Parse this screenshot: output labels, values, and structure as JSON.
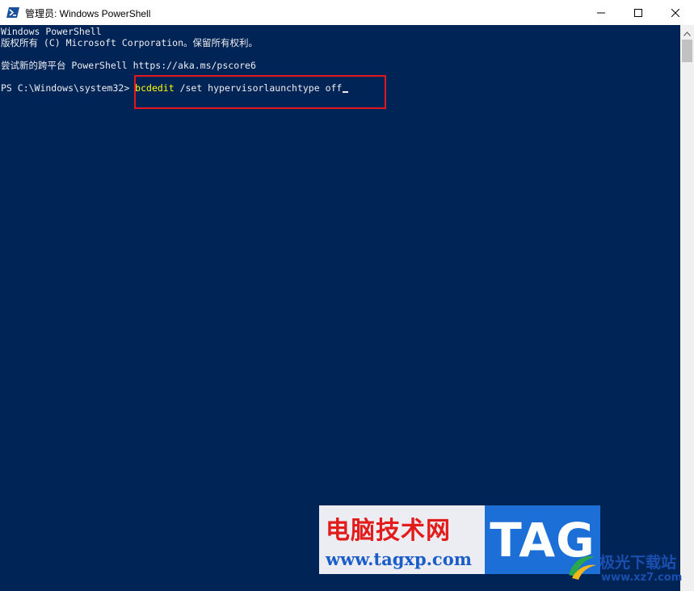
{
  "window": {
    "title": "管理员: Windows PowerShell",
    "controls": {
      "minimize_icon": "minimize-icon",
      "maximize_icon": "maximize-icon",
      "close_icon": "close-icon"
    }
  },
  "console": {
    "lines": [
      "Windows PowerShell",
      "版权所有 (C) Microsoft Corporation。保留所有权利。",
      "",
      "尝试新的跨平台 PowerShell https://aka.ms/pscore6",
      ""
    ],
    "prompt": "PS C:\\Windows\\system32> ",
    "command_keyword": "bcdedit",
    "command_args": " /set hypervisorlaunchtype off",
    "background_color": "#012456",
    "keyword_color": "#ffff00",
    "highlight_color": "#e0171d"
  },
  "watermark": {
    "site_name": "电脑技术网",
    "site_url": "www.tagxp.com",
    "tag_text": "TAG"
  },
  "watermark2": {
    "name": "极光下载站",
    "url": "www.xz7.com"
  }
}
